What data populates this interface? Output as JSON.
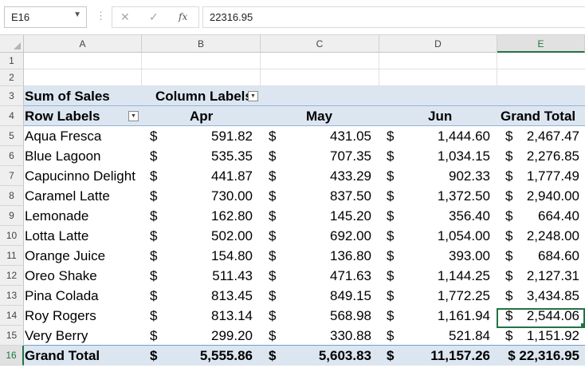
{
  "formula_bar": {
    "name_box": "E16",
    "cancel_icon": "✕",
    "enter_icon": "✓",
    "fx_label": "fx",
    "formula": "22316.95"
  },
  "columns": [
    "A",
    "B",
    "C",
    "D",
    "E"
  ],
  "selected_column": "E",
  "rows": [
    "1",
    "2",
    "3",
    "4",
    "5",
    "6",
    "7",
    "8",
    "9",
    "10",
    "11",
    "12",
    "13",
    "14",
    "15",
    "16"
  ],
  "selected_row": "16",
  "pivot": {
    "values_label": "Sum of Sales",
    "column_labels": "Column Labels",
    "row_labels": "Row Labels",
    "months": [
      "Apr",
      "May",
      "Jun"
    ],
    "grand_total_header": "Grand Total",
    "currency": "$",
    "items": [
      {
        "name": "Aqua Fresca",
        "apr": "591.82",
        "may": "431.05",
        "jun": "1,444.60",
        "total": "2,467.47"
      },
      {
        "name": "Blue Lagoon",
        "apr": "535.35",
        "may": "707.35",
        "jun": "1,034.15",
        "total": "2,276.85"
      },
      {
        "name": "Capucinno Delight",
        "apr": "441.87",
        "may": "433.29",
        "jun": "902.33",
        "total": "1,777.49"
      },
      {
        "name": "Caramel Latte",
        "apr": "730.00",
        "may": "837.50",
        "jun": "1,372.50",
        "total": "2,940.00"
      },
      {
        "name": "Lemonade",
        "apr": "162.80",
        "may": "145.20",
        "jun": "356.40",
        "total": "664.40"
      },
      {
        "name": "Lotta Latte",
        "apr": "502.00",
        "may": "692.00",
        "jun": "1,054.00",
        "total": "2,248.00"
      },
      {
        "name": "Orange Juice",
        "apr": "154.80",
        "may": "136.80",
        "jun": "393.00",
        "total": "684.60"
      },
      {
        "name": "Oreo Shake",
        "apr": "511.43",
        "may": "471.63",
        "jun": "1,144.25",
        "total": "2,127.31"
      },
      {
        "name": "Pina Colada",
        "apr": "813.45",
        "may": "849.15",
        "jun": "1,772.25",
        "total": "3,434.85"
      },
      {
        "name": "Roy Rogers",
        "apr": "813.14",
        "may": "568.98",
        "jun": "1,161.94",
        "total": "2,544.06"
      },
      {
        "name": "Very Berry",
        "apr": "299.20",
        "may": "330.88",
        "jun": "521.84",
        "total": "1,151.92"
      }
    ],
    "grand_total": {
      "name": "Grand Total",
      "apr": "5,555.86",
      "may": "5,603.83",
      "jun": "11,157.26",
      "total": "$ 22,316.95"
    }
  },
  "colors": {
    "pivot_band": "#dce6f1",
    "selection": "#217346"
  }
}
